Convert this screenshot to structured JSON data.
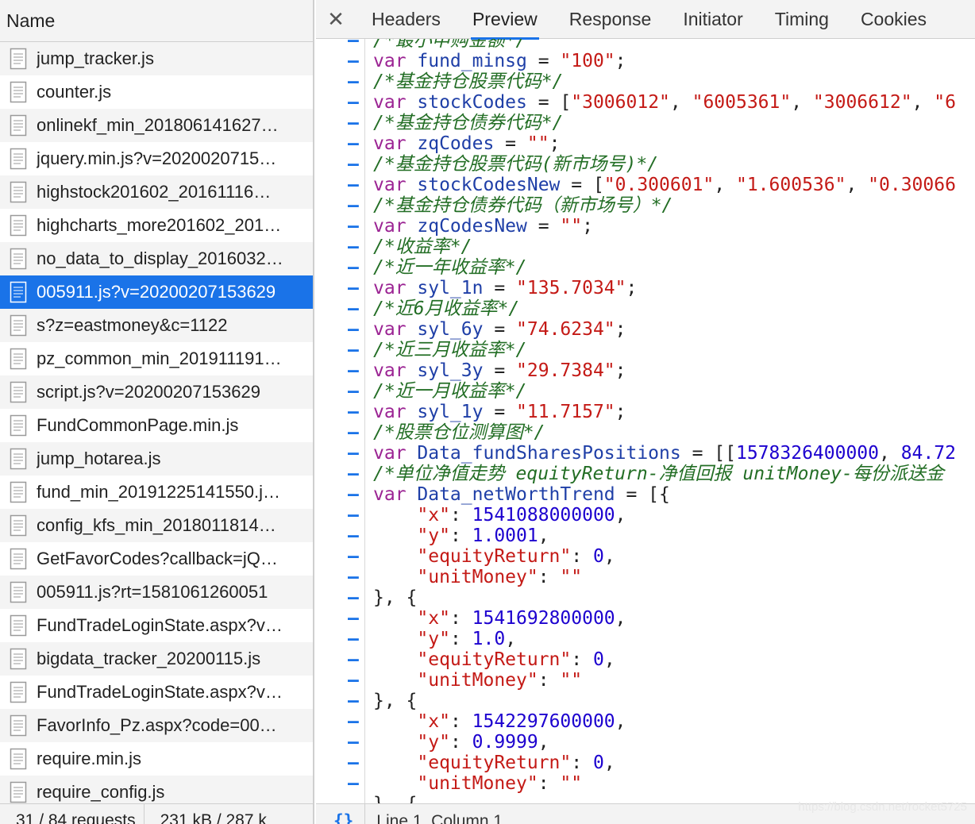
{
  "network_panel": {
    "column_header": "Name",
    "requests": [
      {
        "name": "jump_tracker.js",
        "selected": false
      },
      {
        "name": "counter.js",
        "selected": false
      },
      {
        "name": "onlinekf_min_201806141627…",
        "selected": false
      },
      {
        "name": "jquery.min.js?v=2020020715…",
        "selected": false
      },
      {
        "name": "highstock201602_20161116…",
        "selected": false
      },
      {
        "name": "highcharts_more201602_201…",
        "selected": false
      },
      {
        "name": "no_data_to_display_2016032…",
        "selected": false
      },
      {
        "name": "005911.js?v=20200207153629",
        "selected": true
      },
      {
        "name": "s?z=eastmoney&c=1122",
        "selected": false
      },
      {
        "name": "pz_common_min_201911191…",
        "selected": false
      },
      {
        "name": "script.js?v=20200207153629",
        "selected": false
      },
      {
        "name": "FundCommonPage.min.js",
        "selected": false
      },
      {
        "name": "jump_hotarea.js",
        "selected": false
      },
      {
        "name": "fund_min_20191225141550.j…",
        "selected": false
      },
      {
        "name": "config_kfs_min_2018011814…",
        "selected": false
      },
      {
        "name": "GetFavorCodes?callback=jQ…",
        "selected": false
      },
      {
        "name": "005911.js?rt=1581061260051",
        "selected": false
      },
      {
        "name": "FundTradeLoginState.aspx?v…",
        "selected": false
      },
      {
        "name": "bigdata_tracker_20200115.js",
        "selected": false
      },
      {
        "name": "FundTradeLoginState.aspx?v…",
        "selected": false
      },
      {
        "name": "FavorInfo_Pz.aspx?code=00…",
        "selected": false
      },
      {
        "name": "require.min.js",
        "selected": false
      },
      {
        "name": "require_config.js",
        "selected": false
      }
    ],
    "status": {
      "requests": "31 / 84 requests",
      "transferred": "231 kB / 287 k"
    }
  },
  "detail_panel": {
    "close_icon": "close-icon",
    "tabs": [
      {
        "label": "Headers",
        "active": false
      },
      {
        "label": "Preview",
        "active": true
      },
      {
        "label": "Response",
        "active": false
      },
      {
        "label": "Initiator",
        "active": false
      },
      {
        "label": "Timing",
        "active": false
      },
      {
        "label": "Cookies",
        "active": false
      }
    ],
    "code_lines": [
      [
        [
          "cmt",
          "/*最小申购金额*/"
        ]
      ],
      [
        [
          "kw",
          "var "
        ],
        [
          "id",
          "fund_minsg"
        ],
        [
          "pun",
          " = "
        ],
        [
          "str",
          "\"100\""
        ],
        [
          "pun",
          ";"
        ]
      ],
      [
        [
          "cmt",
          "/*基金持仓股票代码*/"
        ]
      ],
      [
        [
          "kw",
          "var "
        ],
        [
          "id",
          "stockCodes"
        ],
        [
          "pun",
          " = ["
        ],
        [
          "str",
          "\"3006012\""
        ],
        [
          "pun",
          ", "
        ],
        [
          "str",
          "\"6005361\""
        ],
        [
          "pun",
          ", "
        ],
        [
          "str",
          "\"3006612\""
        ],
        [
          "pun",
          ", "
        ],
        [
          "str",
          "\"6"
        ]
      ],
      [
        [
          "cmt",
          "/*基金持仓债券代码*/"
        ]
      ],
      [
        [
          "kw",
          "var "
        ],
        [
          "id",
          "zqCodes"
        ],
        [
          "pun",
          " = "
        ],
        [
          "str",
          "\"\""
        ],
        [
          "pun",
          ";"
        ]
      ],
      [
        [
          "cmt",
          "/*基金持仓股票代码(新市场号)*/"
        ]
      ],
      [
        [
          "kw",
          "var "
        ],
        [
          "id",
          "stockCodesNew"
        ],
        [
          "pun",
          " = ["
        ],
        [
          "str",
          "\"0.300601\""
        ],
        [
          "pun",
          ", "
        ],
        [
          "str",
          "\"1.600536\""
        ],
        [
          "pun",
          ", "
        ],
        [
          "str",
          "\"0.30066"
        ]
      ],
      [
        [
          "cmt",
          "/*基金持仓债券代码（新市场号）*/"
        ]
      ],
      [
        [
          "kw",
          "var "
        ],
        [
          "id",
          "zqCodesNew"
        ],
        [
          "pun",
          " = "
        ],
        [
          "str",
          "\"\""
        ],
        [
          "pun",
          ";"
        ]
      ],
      [
        [
          "cmt",
          "/*收益率*/"
        ]
      ],
      [
        [
          "cmt",
          "/*近一年收益率*/"
        ]
      ],
      [
        [
          "kw",
          "var "
        ],
        [
          "id",
          "syl_1n"
        ],
        [
          "pun",
          " = "
        ],
        [
          "str",
          "\"135.7034\""
        ],
        [
          "pun",
          ";"
        ]
      ],
      [
        [
          "cmt",
          "/*近6月收益率*/"
        ]
      ],
      [
        [
          "kw",
          "var "
        ],
        [
          "id",
          "syl_6y"
        ],
        [
          "pun",
          " = "
        ],
        [
          "str",
          "\"74.6234\""
        ],
        [
          "pun",
          ";"
        ]
      ],
      [
        [
          "cmt",
          "/*近三月收益率*/"
        ]
      ],
      [
        [
          "kw",
          "var "
        ],
        [
          "id",
          "syl_3y"
        ],
        [
          "pun",
          " = "
        ],
        [
          "str",
          "\"29.7384\""
        ],
        [
          "pun",
          ";"
        ]
      ],
      [
        [
          "cmt",
          "/*近一月收益率*/"
        ]
      ],
      [
        [
          "kw",
          "var "
        ],
        [
          "id",
          "syl_1y"
        ],
        [
          "pun",
          " = "
        ],
        [
          "str",
          "\"11.7157\""
        ],
        [
          "pun",
          ";"
        ]
      ],
      [
        [
          "cmt",
          "/*股票仓位测算图*/"
        ]
      ],
      [
        [
          "kw",
          "var "
        ],
        [
          "id",
          "Data_fundSharesPositions"
        ],
        [
          "pun",
          " = [["
        ],
        [
          "num",
          "1578326400000"
        ],
        [
          "pun",
          ", "
        ],
        [
          "num",
          "84.72"
        ]
      ],
      [
        [
          "cmt",
          "/*单位净值走势 equityReturn-净值回报 unitMoney-每份派送金"
        ]
      ],
      [
        [
          "kw",
          "var "
        ],
        [
          "id",
          "Data_netWorthTrend"
        ],
        [
          "pun",
          " = [{"
        ]
      ],
      [
        [
          "pun",
          "    "
        ],
        [
          "key",
          "\"x\""
        ],
        [
          "pun",
          ": "
        ],
        [
          "num",
          "1541088000000"
        ],
        [
          "pun",
          ","
        ]
      ],
      [
        [
          "pun",
          "    "
        ],
        [
          "key",
          "\"y\""
        ],
        [
          "pun",
          ": "
        ],
        [
          "num",
          "1.0001"
        ],
        [
          "pun",
          ","
        ]
      ],
      [
        [
          "pun",
          "    "
        ],
        [
          "key",
          "\"equityReturn\""
        ],
        [
          "pun",
          ": "
        ],
        [
          "num",
          "0"
        ],
        [
          "pun",
          ","
        ]
      ],
      [
        [
          "pun",
          "    "
        ],
        [
          "key",
          "\"unitMoney\""
        ],
        [
          "pun",
          ": "
        ],
        [
          "str",
          "\"\""
        ]
      ],
      [
        [
          "pun",
          "}, {"
        ]
      ],
      [
        [
          "pun",
          "    "
        ],
        [
          "key",
          "\"x\""
        ],
        [
          "pun",
          ": "
        ],
        [
          "num",
          "1541692800000"
        ],
        [
          "pun",
          ","
        ]
      ],
      [
        [
          "pun",
          "    "
        ],
        [
          "key",
          "\"y\""
        ],
        [
          "pun",
          ": "
        ],
        [
          "num",
          "1.0"
        ],
        [
          "pun",
          ","
        ]
      ],
      [
        [
          "pun",
          "    "
        ],
        [
          "key",
          "\"equityReturn\""
        ],
        [
          "pun",
          ": "
        ],
        [
          "num",
          "0"
        ],
        [
          "pun",
          ","
        ]
      ],
      [
        [
          "pun",
          "    "
        ],
        [
          "key",
          "\"unitMoney\""
        ],
        [
          "pun",
          ": "
        ],
        [
          "str",
          "\"\""
        ]
      ],
      [
        [
          "pun",
          "}, {"
        ]
      ],
      [
        [
          "pun",
          "    "
        ],
        [
          "key",
          "\"x\""
        ],
        [
          "pun",
          ": "
        ],
        [
          "num",
          "1542297600000"
        ],
        [
          "pun",
          ","
        ]
      ],
      [
        [
          "pun",
          "    "
        ],
        [
          "key",
          "\"y\""
        ],
        [
          "pun",
          ": "
        ],
        [
          "num",
          "0.9999"
        ],
        [
          "pun",
          ","
        ]
      ],
      [
        [
          "pun",
          "    "
        ],
        [
          "key",
          "\"equityReturn\""
        ],
        [
          "pun",
          ": "
        ],
        [
          "num",
          "0"
        ],
        [
          "pun",
          ","
        ]
      ],
      [
        [
          "pun",
          "    "
        ],
        [
          "key",
          "\"unitMoney\""
        ],
        [
          "pun",
          ": "
        ],
        [
          "str",
          "\"\""
        ]
      ],
      [
        [
          "pun",
          "}, {"
        ]
      ]
    ],
    "status": {
      "braces": "{}",
      "position": "Line 1, Column 1"
    }
  },
  "watermark": "https://blog.csdn.net/rocket5725"
}
